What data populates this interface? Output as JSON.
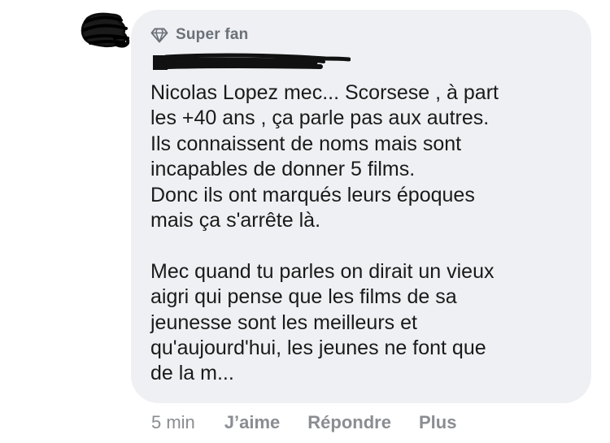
{
  "comment": {
    "badge": {
      "icon": "diamond-icon",
      "label": "Super fan"
    },
    "text": "Nicolas Lopez mec... Scorsese , à part\nles +40 ans , ça parle pas aux autres.\nIls connaissent de noms mais sont\nincapables de donner 5 films.\nDonc ils ont marqués leurs époques\nmais ça s'arrête là.\n\nMec quand tu parles on dirait un vieux\naigri qui pense que les films de sa\njeunesse sont les meilleurs et\nqu'aujourd'hui, les jeunes ne font que\nde la m...",
    "timestamp": "5 min",
    "actions": {
      "like": "J’aime",
      "reply": "Répondre",
      "more": "Plus"
    }
  },
  "colors": {
    "bubble_background": "#eff0f3",
    "secondary_text": "#8a8d91",
    "badge_text": "#6b7079",
    "primary_text": "#1a1a1a",
    "redaction": "#111111"
  }
}
